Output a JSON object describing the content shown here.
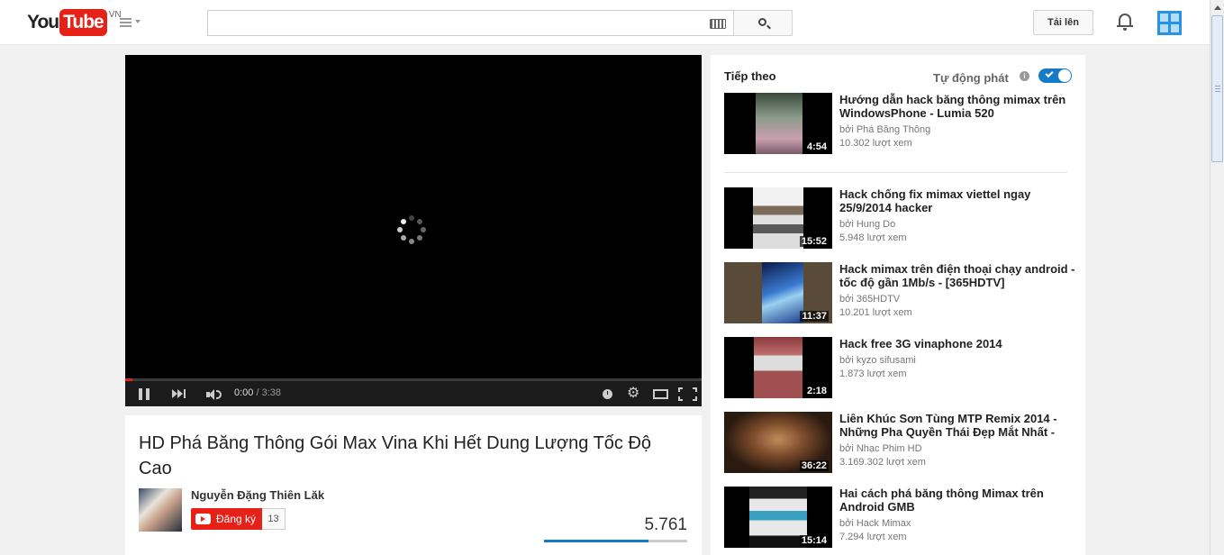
{
  "header": {
    "logo_you": "You",
    "logo_tube": "Tube",
    "logo_country": "VN",
    "search_value": "",
    "upload_label": "Tải lên"
  },
  "player": {
    "current_time": "0:00",
    "duration": "3:38",
    "duration_sep": " / "
  },
  "video": {
    "title": "HD Phá Băng Thông Gói Max Vina Khi Hết Dung Lượng Tốc Độ Cao",
    "channel": "Nguyễn Đặng Thiên Lăk",
    "subscribe_label": "Đăng ký",
    "subscriber_count": "13",
    "views": "5.761"
  },
  "sidebar": {
    "up_next": "Tiếp theo",
    "autoplay": "Tự động phát",
    "autoplay_info": "i",
    "autoplay_on": true,
    "videos": [
      {
        "title": "Hướng dẫn hack băng thông mimax trên WindowsPhone - Lumia 520",
        "channel": "bởi Phá Băng Thông",
        "views": "10.302 lượt xem",
        "duration": "4:54"
      },
      {
        "title": "Hack chống fix mimax viettel ngay 25/9/2014 hacker",
        "channel": "bởi Hung Do",
        "views": "5.948 lượt xem",
        "duration": "15:52"
      },
      {
        "title": "Hack mimax trên điện thoại chạy android - tốc độ gần 1Mb/s - [365HDTV]",
        "channel": "bởi 365HDTV",
        "views": "10.201 lượt xem",
        "duration": "11:37"
      },
      {
        "title": "Hack free 3G vinaphone 2014",
        "channel": "bởi kyzo sifusami",
        "views": "1.873 lượt xem",
        "duration": "2:18"
      },
      {
        "title": "Liên Khúc Sơn Tùng MTP Remix 2014 - Những Pha Quyền Thái Đẹp Mắt Nhất -",
        "channel": "bởi Nhạc Phim HD",
        "views": "3.169.302 lượt xem",
        "duration": "36:22"
      },
      {
        "title": "Hai cách phá băng thông Mimax trên Android GMB",
        "channel": "bởi Hack Mimax",
        "views": "7.294 lượt xem",
        "duration": "15:14"
      }
    ]
  },
  "colors": {
    "brand_red": "#e62117",
    "accent_blue": "#167ac6"
  }
}
